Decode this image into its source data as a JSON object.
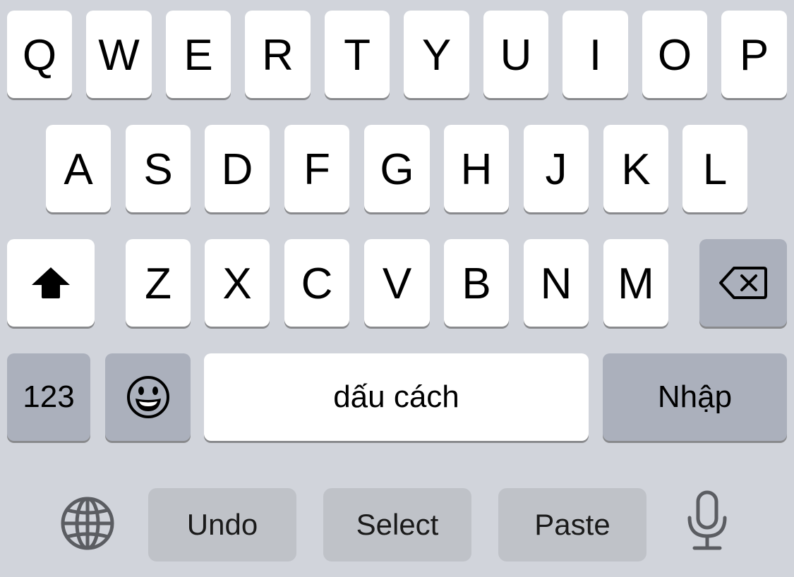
{
  "keyboard": {
    "row1": [
      "Q",
      "W",
      "E",
      "R",
      "T",
      "Y",
      "U",
      "I",
      "O",
      "P"
    ],
    "row2": [
      "A",
      "S",
      "D",
      "F",
      "G",
      "H",
      "J",
      "K",
      "L"
    ],
    "row3": [
      "Z",
      "X",
      "C",
      "V",
      "B",
      "N",
      "M"
    ],
    "numbers_label": "123",
    "space_label": "dấu cách",
    "return_label": "Nhập"
  },
  "toolbar": {
    "undo_label": "Undo",
    "select_label": "Select",
    "paste_label": "Paste"
  },
  "icons": {
    "shift": "shift-icon",
    "delete": "delete-icon",
    "emoji": "emoji-icon",
    "globe": "globe-icon",
    "microphone": "microphone-icon"
  },
  "colors": {
    "background": "#d1d4db",
    "key": "#ffffff",
    "special_key": "#abb0bc",
    "toolbar_pill": "#bfc2c8"
  }
}
